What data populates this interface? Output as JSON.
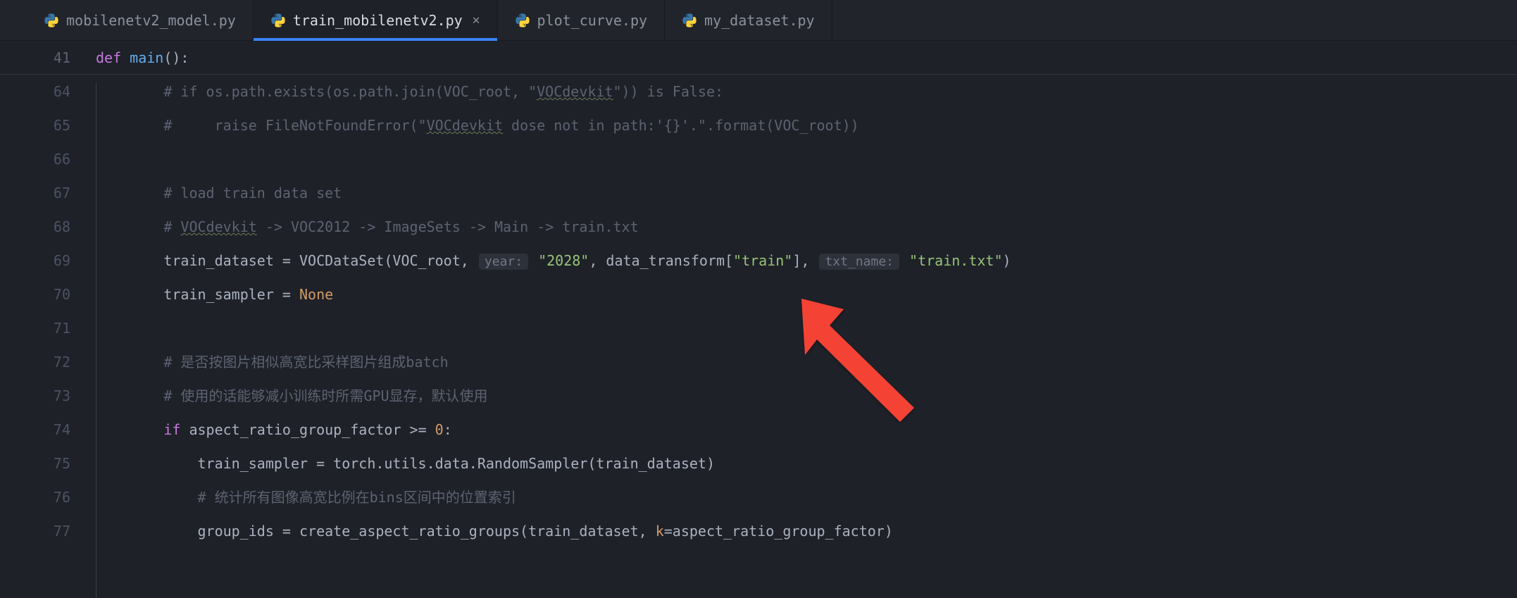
{
  "tabs": [
    {
      "name": "mobilenetv2_model.py",
      "active": false,
      "closeable": false
    },
    {
      "name": "train_mobilenetv2.py",
      "active": true,
      "closeable": true
    },
    {
      "name": "plot_curve.py",
      "active": false,
      "closeable": false
    },
    {
      "name": "my_dataset.py",
      "active": false,
      "closeable": false
    }
  ],
  "sticky": {
    "line_no": "41",
    "kw_def": "def ",
    "fn_name": "main",
    "suffix": "():"
  },
  "gutter": [
    "64",
    "65",
    "66",
    "67",
    "68",
    "69",
    "70",
    "71",
    "72",
    "73",
    "74",
    "75",
    "76",
    "77"
  ],
  "inlay": {
    "year": "year:",
    "txt_name": "txt_name:"
  },
  "code": {
    "l64a": "        # if os.path.exists(os.path.join(VOC_root, \"",
    "l64b": "VOCdevkit",
    "l64c": "\")) is False:",
    "l65a": "        #     raise FileNotFoundError(\"",
    "l65b": "VOCdevkit",
    "l65c": " dose not in path:'{}'.\".format(VOC_root))",
    "l66": "",
    "l67": "        # load train data set",
    "l68a": "        # ",
    "l68b": "VOCdevkit",
    "l68c": " -> VOC2012 -> ImageSets -> Main -> train.txt",
    "l69a": "        train_dataset = VOCDataSet(VOC_root, ",
    "l69b": " \"2028\"",
    "l69c": ", data_transform[",
    "l69d": "\"train\"",
    "l69e": "], ",
    "l69f": " \"train.txt\"",
    "l69g": ")",
    "l70a": "        train_sampler = ",
    "l70b": "None",
    "l71": "",
    "l72": "        # 是否按图片相似高宽比采样图片组成batch",
    "l73": "        # 使用的话能够减小训练时所需GPU显存，默认使用",
    "l74a": "        ",
    "l74b": "if",
    "l74c": " aspect_ratio_group_factor >= ",
    "l74d": "0",
    "l74e": ":",
    "l75": "            train_sampler = torch.utils.data.RandomSampler(train_dataset)",
    "l76": "            # 统计所有图像高宽比例在bins区间中的位置索引",
    "l77a": "            group_ids = create_aspect_ratio_groups(train_dataset, ",
    "l77b": "k",
    "l77c": "=aspect_ratio_group_factor)"
  }
}
